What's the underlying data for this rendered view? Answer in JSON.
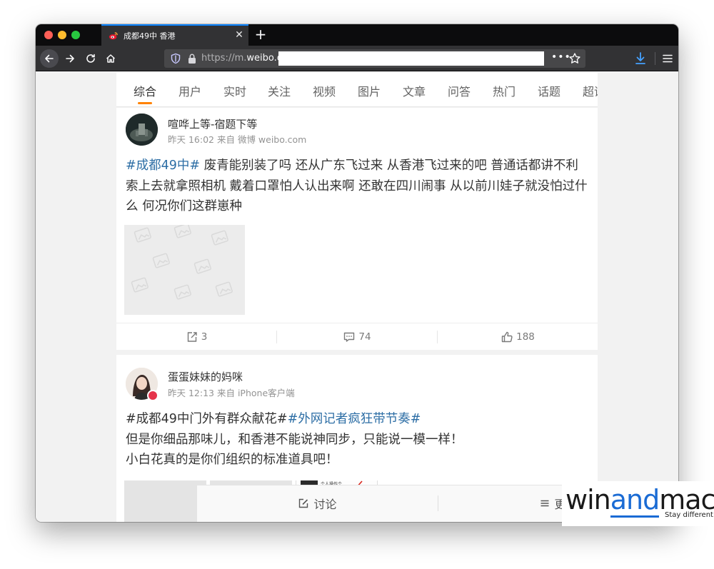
{
  "browser": {
    "tab": {
      "title": "成都49中 香港",
      "close": "✕"
    },
    "new_tab": "+",
    "url": {
      "prefix": "https://m.",
      "domain": "weibo.cn",
      "suffix": "/"
    },
    "url_more": "•••"
  },
  "filter_tabs": [
    "综合",
    "用户",
    "实时",
    "关注",
    "视频",
    "图片",
    "文章",
    "问答",
    "热门",
    "话题",
    "超话"
  ],
  "posts": [
    {
      "username": "喧哗上等-宿题下等",
      "meta": "昨天 16:02 来自 微博 weibo.com",
      "hashtag": "#成都49中#",
      "text": " 废青能别装了吗 还从广东飞过来 从香港飞过来的吧 普通话都讲不利索上去就拿照相机 戴着口罩怕人认出来啊 还敢在四川闹事 从以前川娃子就没怕过什么 何况你们这群崽种",
      "reposts": "3",
      "comments": "74",
      "likes": "188"
    },
    {
      "username": "蛋蛋妹妹的妈咪",
      "meta": "昨天 12:13 来自 iPhone客户端",
      "line1_plain": "#成都49中门外有群众献花#",
      "line1_hashtag": "#外网记者疯狂带节奏#",
      "line2": "但是你细品那味儿，和香港不能说神同步，只能说一模一样！",
      "line3": "小白花真的是你们组织的标准道具吧！",
      "thumb_caption": "个人操作个"
    }
  ],
  "bottom_bar": {
    "discuss": "讨论",
    "more": "更多"
  },
  "watermark": {
    "part1": "win",
    "part2": "and",
    "part3": "mac",
    "tagline": "Stay different"
  },
  "colors": {
    "accent": "#ff8200",
    "link": "#2d6ea5",
    "browser_dark": "#323234"
  }
}
